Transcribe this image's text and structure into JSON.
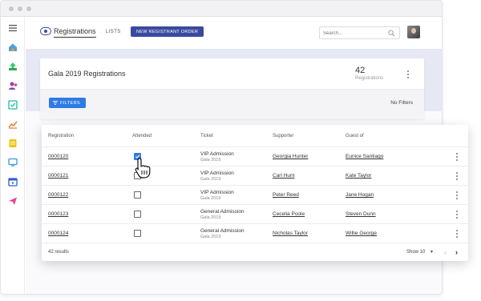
{
  "header": {
    "nav_title": "Registrations",
    "nav_lists": "LISTS",
    "new_button": "NEW REGISTRANT ORDER",
    "search_placeholder": "Search..."
  },
  "summary": {
    "title": "Gala 2019 Registrations",
    "count": "42",
    "count_label": "Registrations",
    "filters_button": "FILTERS",
    "filters_status": "No Filters"
  },
  "table": {
    "columns": [
      "Registration",
      "Attended",
      "Ticket",
      "Supporter",
      "Guest of"
    ],
    "rows": [
      {
        "id": "0000120",
        "attended": true,
        "ticket": "VIP Admission",
        "event": "Gala 2019",
        "supporter": "Georgia Hunter",
        "guest_of": "Eunice Santiago"
      },
      {
        "id": "0000121",
        "attended": false,
        "ticket": "VIP Admission",
        "event": "Gala 2019",
        "supporter": "Carl Hunt",
        "guest_of": "Kate Taylor"
      },
      {
        "id": "0000122",
        "attended": false,
        "ticket": "VIP Admission",
        "event": "Gala 2019",
        "supporter": "Peter Reed",
        "guest_of": "Jane Hogan"
      },
      {
        "id": "0000123",
        "attended": false,
        "ticket": "General Admission",
        "event": "Gala 2019",
        "supporter": "Cecelia Poole",
        "guest_of": "Steven Dunn"
      },
      {
        "id": "0000124",
        "attended": false,
        "ticket": "General Admission",
        "event": "Gala 2019",
        "supporter": "Nicholas Taylor",
        "guest_of": "Willie George"
      }
    ],
    "results": "42 results",
    "show": "Show 10"
  },
  "sidebar_icons": [
    "home-icon",
    "upload-icon",
    "people-icon",
    "checklist-icon",
    "chart-icon",
    "notes-icon",
    "monitor-icon",
    "calendar-icon",
    "send-icon"
  ],
  "colors": {
    "accent": "#3a4a9f",
    "primary_blue": "#2f7be5",
    "header_band": "#e6e8f4"
  }
}
